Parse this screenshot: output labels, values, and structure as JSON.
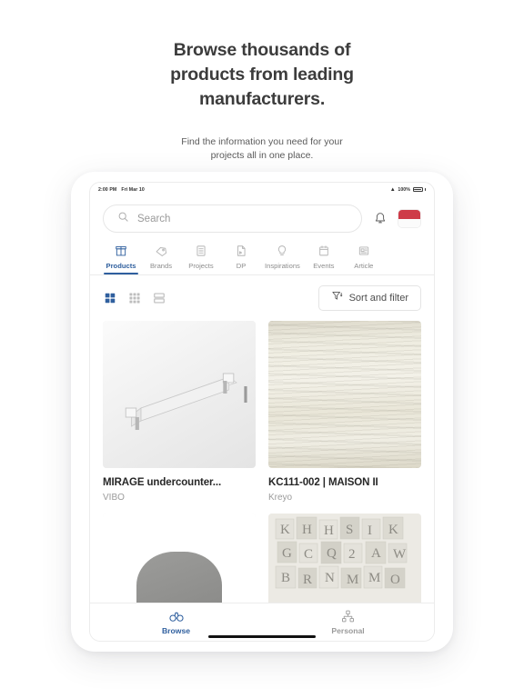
{
  "promo": {
    "title": "Browse thousands of products from leading manufacturers.",
    "subtitle": "Find the information you need for your projects all in one place."
  },
  "statusbar": {
    "time": "2:00 PM",
    "date": "Fri Mar 10",
    "wifi_icon": "wifi-icon",
    "battery_percent": "100%",
    "battery_icon": "battery-full-icon"
  },
  "search": {
    "placeholder": "Search",
    "icon": "search-icon"
  },
  "header_actions": {
    "notifications_icon": "bell-icon",
    "avatar": "flag-avatar",
    "avatar_colors": {
      "top": "#ce3b48",
      "bottom": "#fbfbfb"
    }
  },
  "tabs": [
    {
      "label": "Products",
      "icon": "box-icon",
      "active": true
    },
    {
      "label": "Brands",
      "icon": "tag-icon",
      "active": false
    },
    {
      "label": "Projects",
      "icon": "list-icon",
      "active": false
    },
    {
      "label": "DP",
      "icon": "document-icon",
      "active": false
    },
    {
      "label": "Inspirations",
      "icon": "lightbulb-icon",
      "active": false
    },
    {
      "label": "Events",
      "icon": "calendar-icon",
      "active": false
    },
    {
      "label": "Article",
      "icon": "article-icon",
      "active": false
    }
  ],
  "toolbar": {
    "views": [
      {
        "name": "grid-large-view-icon",
        "active": true
      },
      {
        "name": "grid-small-view-icon",
        "active": false
      },
      {
        "name": "list-view-icon",
        "active": false
      }
    ],
    "sort_label": "Sort and filter",
    "sort_icon": "filter-icon"
  },
  "products": [
    {
      "title": "MIRAGE undercounter...",
      "brand": "VIBO",
      "art": "towel"
    },
    {
      "title": "KC111-002 | MAISON II",
      "brand": "Kreyo",
      "art": "stone"
    },
    {
      "title": "",
      "brand": "",
      "art": "pillow"
    },
    {
      "title": "",
      "brand": "",
      "art": "letters"
    }
  ],
  "bottom_nav": [
    {
      "label": "Browse",
      "icon": "binoculars-icon",
      "active": true
    },
    {
      "label": "Personal",
      "icon": "personal-icon",
      "active": false
    }
  ],
  "colors": {
    "accent_blue": "#2f5f9e",
    "avatar_red": "#ce3b48",
    "text_dark": "#272727",
    "text_muted": "#9b9b9b"
  }
}
